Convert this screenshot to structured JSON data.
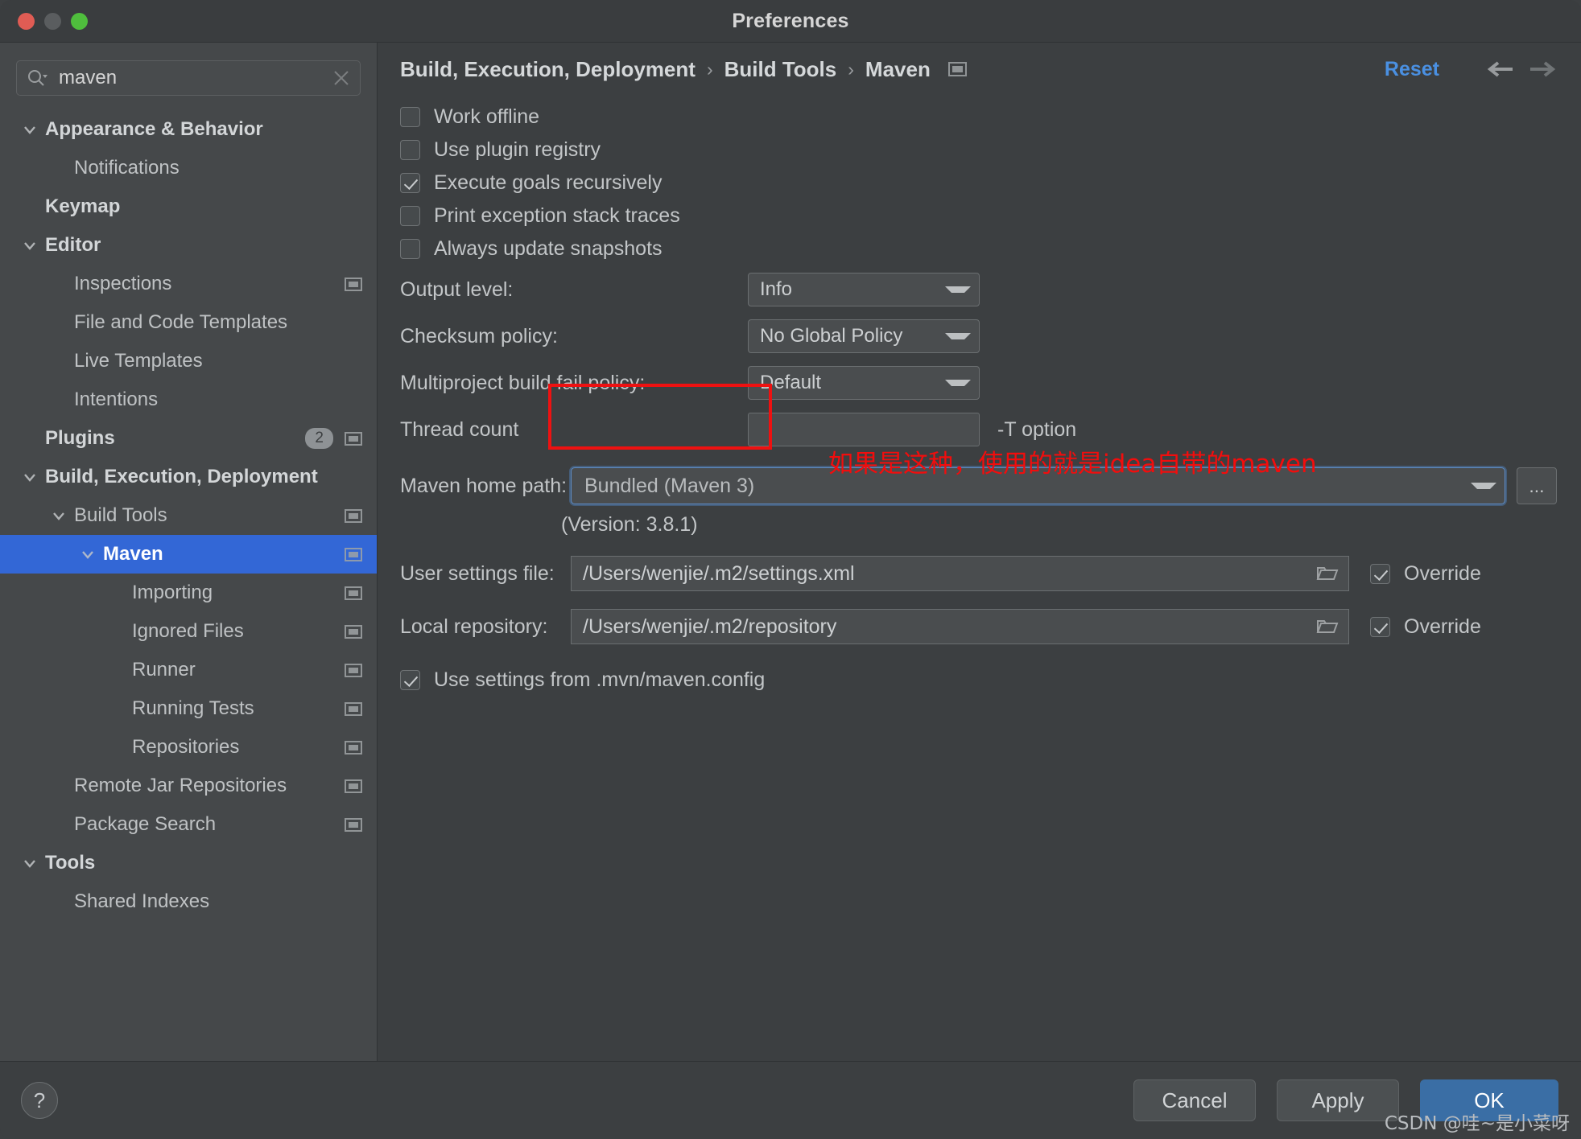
{
  "window": {
    "title": "Preferences",
    "traffic_lights": [
      "close",
      "minimize",
      "zoom"
    ]
  },
  "sidebar": {
    "search": {
      "value": "maven",
      "placeholder": ""
    },
    "items": [
      {
        "label": "Appearance & Behavior",
        "indent": 0,
        "bold": true,
        "chevron": "down",
        "selected": false,
        "badge": "",
        "modicon": false
      },
      {
        "label": "Notifications",
        "indent": 1,
        "bold": false,
        "chevron": "",
        "selected": false,
        "badge": "",
        "modicon": false
      },
      {
        "label": "Keymap",
        "indent": 0,
        "bold": true,
        "chevron": "",
        "selected": false,
        "badge": "",
        "modicon": false
      },
      {
        "label": "Editor",
        "indent": 0,
        "bold": true,
        "chevron": "down",
        "selected": false,
        "badge": "",
        "modicon": false
      },
      {
        "label": "Inspections",
        "indent": 1,
        "bold": false,
        "chevron": "",
        "selected": false,
        "badge": "",
        "modicon": true
      },
      {
        "label": "File and Code Templates",
        "indent": 1,
        "bold": false,
        "chevron": "",
        "selected": false,
        "badge": "",
        "modicon": false
      },
      {
        "label": "Live Templates",
        "indent": 1,
        "bold": false,
        "chevron": "",
        "selected": false,
        "badge": "",
        "modicon": false
      },
      {
        "label": "Intentions",
        "indent": 1,
        "bold": false,
        "chevron": "",
        "selected": false,
        "badge": "",
        "modicon": false
      },
      {
        "label": "Plugins",
        "indent": 0,
        "bold": true,
        "chevron": "",
        "selected": false,
        "badge": "2",
        "modicon": true
      },
      {
        "label": "Build, Execution, Deployment",
        "indent": 0,
        "bold": true,
        "chevron": "down",
        "selected": false,
        "badge": "",
        "modicon": false
      },
      {
        "label": "Build Tools",
        "indent": 1,
        "bold": false,
        "chevron": "down",
        "selected": false,
        "badge": "",
        "modicon": true
      },
      {
        "label": "Maven",
        "indent": 2,
        "bold": true,
        "chevron": "down",
        "selected": true,
        "badge": "",
        "modicon": true
      },
      {
        "label": "Importing",
        "indent": 3,
        "bold": false,
        "chevron": "",
        "selected": false,
        "badge": "",
        "modicon": true
      },
      {
        "label": "Ignored Files",
        "indent": 3,
        "bold": false,
        "chevron": "",
        "selected": false,
        "badge": "",
        "modicon": true
      },
      {
        "label": "Runner",
        "indent": 3,
        "bold": false,
        "chevron": "",
        "selected": false,
        "badge": "",
        "modicon": true
      },
      {
        "label": "Running Tests",
        "indent": 3,
        "bold": false,
        "chevron": "",
        "selected": false,
        "badge": "",
        "modicon": true
      },
      {
        "label": "Repositories",
        "indent": 3,
        "bold": false,
        "chevron": "",
        "selected": false,
        "badge": "",
        "modicon": true
      },
      {
        "label": "Remote Jar Repositories",
        "indent": 1,
        "bold": false,
        "chevron": "",
        "selected": false,
        "badge": "",
        "modicon": true
      },
      {
        "label": "Package Search",
        "indent": 1,
        "bold": false,
        "chevron": "",
        "selected": false,
        "badge": "",
        "modicon": true
      },
      {
        "label": "Tools",
        "indent": 0,
        "bold": true,
        "chevron": "down",
        "selected": false,
        "badge": "",
        "modicon": false
      },
      {
        "label": "Shared Indexes",
        "indent": 1,
        "bold": false,
        "chevron": "",
        "selected": false,
        "badge": "",
        "modicon": false
      }
    ]
  },
  "header": {
    "breadcrumbs": [
      "Build, Execution, Deployment",
      "Build Tools",
      "Maven"
    ],
    "separator": "›",
    "reset_label": "Reset",
    "back_icon": "arrow-left-icon",
    "forward_icon": "arrow-right-icon"
  },
  "main": {
    "checkboxes": [
      {
        "label": "Work offline",
        "checked": false
      },
      {
        "label": "Use plugin registry",
        "checked": false
      },
      {
        "label": "Execute goals recursively",
        "checked": true
      },
      {
        "label": "Print exception stack traces",
        "checked": false
      },
      {
        "label": "Always update snapshots",
        "checked": false
      }
    ],
    "fields": [
      {
        "label": "Output level:",
        "value": "Info",
        "type": "combo"
      },
      {
        "label": "Checksum policy:",
        "value": "No Global Policy",
        "type": "combo"
      },
      {
        "label": "Multiproject build fail policy:",
        "value": "Default",
        "type": "combo"
      },
      {
        "label": "Thread count",
        "value": "",
        "type": "text",
        "suffix": "-T option"
      }
    ],
    "maven_home": {
      "label": "Maven home path:",
      "value": "Bundled (Maven 3)",
      "browse_label": "...",
      "version_note": "(Version: 3.8.1)"
    },
    "annotation": "如果是这种，使用的就是idea自带的maven",
    "paths": [
      {
        "label": "User settings file:",
        "value": "/Users/wenjie/.m2/settings.xml",
        "override_label": "Override",
        "override_checked": true
      },
      {
        "label": "Local repository:",
        "value": "/Users/wenjie/.m2/repository",
        "override_label": "Override",
        "override_checked": true
      }
    ],
    "bottom_checkbox": {
      "label": "Use settings from .mvn/maven.config",
      "checked": true
    }
  },
  "footer": {
    "help_label": "?",
    "cancel_label": "Cancel",
    "apply_label": "Apply",
    "ok_label": "OK",
    "watermark": "CSDN @哇~是小菜呀"
  },
  "colors": {
    "selection_blue": "#3367d6",
    "accent_link": "#4a90e2",
    "primary_button": "#3a6ea5",
    "annotation_red": "#f20d0d",
    "highlight_box": "#ee1111"
  }
}
